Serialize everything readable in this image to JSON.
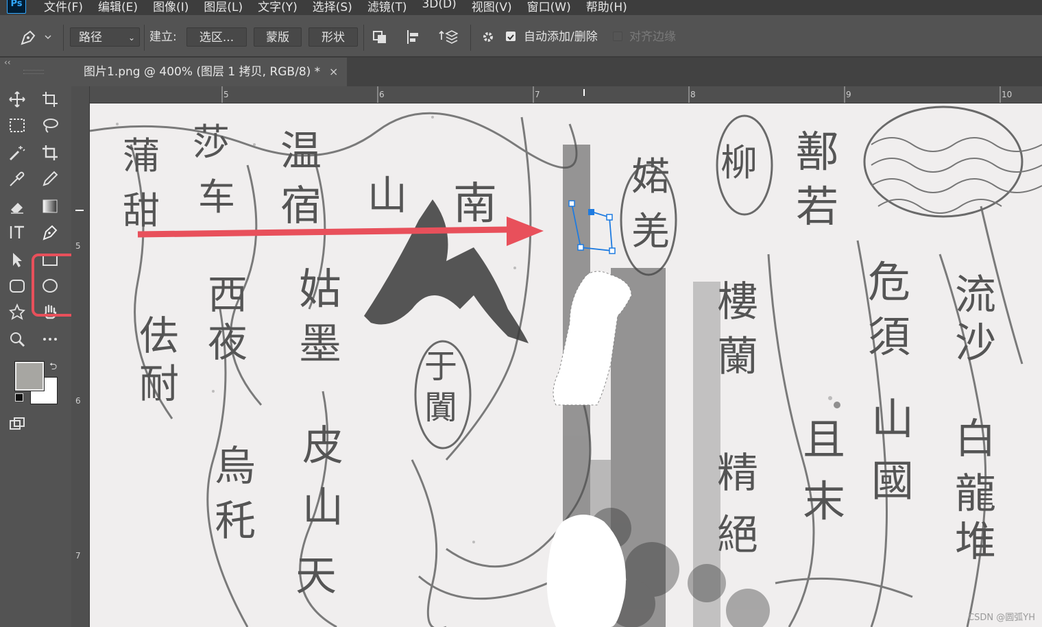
{
  "app": {
    "logo": "Ps"
  },
  "menu": [
    "文件(F)",
    "编辑(E)",
    "图像(I)",
    "图层(L)",
    "文字(Y)",
    "选择(S)",
    "滤镜(T)",
    "3D(D)",
    "视图(V)",
    "窗口(W)",
    "帮助(H)"
  ],
  "options": {
    "mode_select": "路径",
    "make_label": "建立:",
    "selection_btn": "选区...",
    "mask_btn": "蒙版",
    "shape_btn": "形状",
    "auto_add_delete": "自动添加/删除",
    "auto_add_checked": true,
    "align_edges": "对齐边缘",
    "align_edges_checked": false
  },
  "document": {
    "tab_title": "图片1.png @ 400% (图层 1 拷贝, RGB/8) *",
    "close": "×"
  },
  "ruler": {
    "top": [
      "5",
      "6",
      "7",
      "8",
      "9",
      "10"
    ],
    "left": [
      "5",
      "6",
      "7"
    ]
  },
  "canvas_text": [
    "蒲",
    "甜",
    "莎",
    "车",
    "温",
    "宿",
    "山",
    "南",
    "西",
    "夜",
    "佉",
    "耐",
    "烏",
    "秅",
    "姑",
    "墨",
    "皮",
    "山",
    "天",
    "于",
    "闐",
    "鄯",
    "若",
    "且",
    "末",
    "危",
    "須",
    "山",
    "國",
    "流",
    "沙",
    "白",
    "龍",
    "堆",
    "婼",
    "羌",
    "樓",
    "蘭",
    "精",
    "絕",
    "柳"
  ],
  "watermark": "CSDN @圆弧YH",
  "colors": {
    "accent": "#e8505b",
    "ps_blue": "#31a8ff",
    "path_blue": "#1e7be0"
  }
}
